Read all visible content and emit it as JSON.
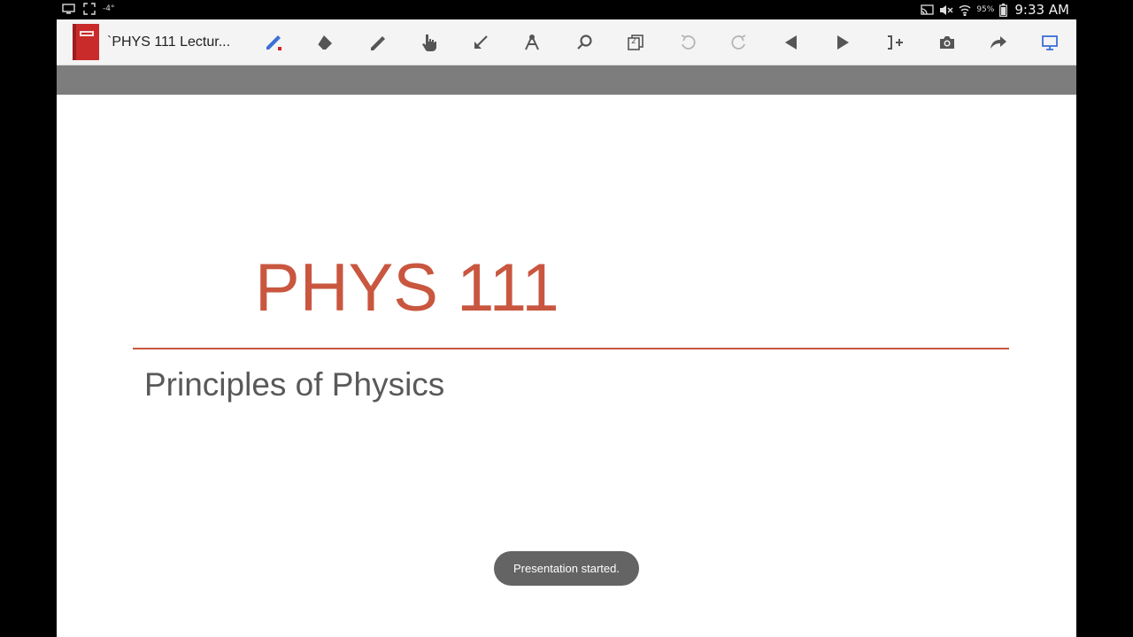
{
  "status_bar": {
    "temperature": "-4°",
    "battery_percent": "95%",
    "time": "9:33 AM",
    "left_icons": [
      "cast-screen-icon",
      "screenshot-frame-icon"
    ],
    "right_icons": [
      "cast-icon",
      "mute-icon",
      "wifi-icon",
      "battery-icon"
    ]
  },
  "toolbar": {
    "document_title": "`PHYS 111 Lectur...",
    "tools": [
      "pen-icon",
      "eraser-icon",
      "highlighter-icon",
      "hand-pointer-icon",
      "arrow-pointer-icon",
      "compass-icon",
      "search-icon",
      "page-number-icon",
      "undo-icon",
      "redo-icon",
      "previous-slide-icon",
      "next-slide-icon",
      "insert-blank-icon",
      "camera-icon",
      "share-icon",
      "presentation-icon"
    ],
    "page_indicator": "2",
    "colors": {
      "active": "#3a6fd8",
      "pen_dot": "#d2232a",
      "inactive": "#555555",
      "disabled": "#b5b5b5"
    }
  },
  "slide": {
    "title": "PHYS 111",
    "subtitle": "Principles of Physics",
    "colors": {
      "title": "#c9563f",
      "subtitle": "#595959"
    }
  },
  "toast": {
    "message": "Presentation started."
  }
}
